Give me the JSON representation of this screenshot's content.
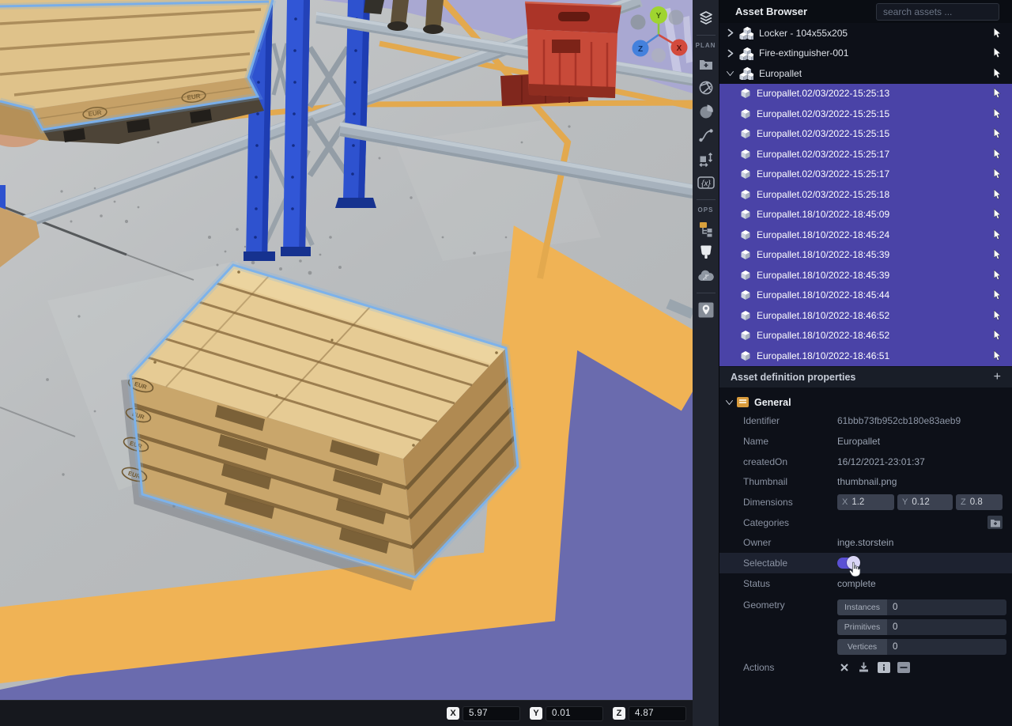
{
  "viewport": {
    "gizmo_axes": {
      "x": "X",
      "y": "Y",
      "z": "Z"
    },
    "status_bar": {
      "x_label": "X",
      "x_value": "5.97",
      "y_label": "Y",
      "y_value": "0.01",
      "z_label": "Z",
      "z_value": "4.87"
    },
    "pallet_brand": "EUR"
  },
  "toolbar": {
    "plan_label": "PLAN",
    "ops_label": "OPS",
    "icons": [
      "assets-stack",
      "add-folder",
      "shutter",
      "pie-chart",
      "spline",
      "measure",
      "variables",
      "structure",
      "paddle",
      "cloud-network",
      "map-location"
    ]
  },
  "asset_browser": {
    "title": "Asset Browser",
    "search_placeholder": "search assets ...",
    "tree": [
      {
        "label": "Locker - 104x55x205",
        "type": "definition",
        "expanded": false,
        "selected": false
      },
      {
        "label": "Fire-extinguisher-001",
        "type": "definition",
        "expanded": false,
        "selected": false
      },
      {
        "label": "Europallet",
        "type": "definition",
        "expanded": true,
        "selected": false
      },
      {
        "label": "Europallet.02/03/2022-15:25:13",
        "type": "instance",
        "selected": true
      },
      {
        "label": "Europallet.02/03/2022-15:25:15",
        "type": "instance",
        "selected": true
      },
      {
        "label": "Europallet.02/03/2022-15:25:15",
        "type": "instance",
        "selected": true
      },
      {
        "label": "Europallet.02/03/2022-15:25:17",
        "type": "instance",
        "selected": true
      },
      {
        "label": "Europallet.02/03/2022-15:25:17",
        "type": "instance",
        "selected": true
      },
      {
        "label": "Europallet.02/03/2022-15:25:18",
        "type": "instance",
        "selected": true
      },
      {
        "label": "Europallet.18/10/2022-18:45:09",
        "type": "instance",
        "selected": true
      },
      {
        "label": "Europallet.18/10/2022-18:45:24",
        "type": "instance",
        "selected": true
      },
      {
        "label": "Europallet.18/10/2022-18:45:39",
        "type": "instance",
        "selected": true
      },
      {
        "label": "Europallet.18/10/2022-18:45:39",
        "type": "instance",
        "selected": true
      },
      {
        "label": "Europallet.18/10/2022-18:45:44",
        "type": "instance",
        "selected": true
      },
      {
        "label": "Europallet.18/10/2022-18:46:52",
        "type": "instance",
        "selected": true
      },
      {
        "label": "Europallet.18/10/2022-18:46:52",
        "type": "instance",
        "selected": true
      },
      {
        "label": "Europallet.18/10/2022-18:46:51",
        "type": "instance",
        "selected": true
      }
    ]
  },
  "properties": {
    "header": "Asset definition properties",
    "add_button": "+",
    "section": "General",
    "rows": {
      "identifier": {
        "label": "Identifier",
        "value": "61bbb73fb952cb180e83aeb9"
      },
      "name": {
        "label": "Name",
        "value": "Europallet"
      },
      "created_on": {
        "label": "createdOn",
        "value": "16/12/2021-23:01:37"
      },
      "thumbnail": {
        "label": "Thumbnail",
        "value": "thumbnail.png"
      },
      "dimensions": {
        "label": "Dimensions",
        "x_label": "X",
        "x": "1.2",
        "y_label": "Y",
        "y": "0.12",
        "z_label": "Z",
        "z": "0.8"
      },
      "categories": {
        "label": "Categories"
      },
      "owner": {
        "label": "Owner",
        "value": "inge.storstein"
      },
      "selectable": {
        "label": "Selectable",
        "on": true
      },
      "status": {
        "label": "Status",
        "value": "complete"
      },
      "geometry": {
        "label": "Geometry",
        "fields": [
          {
            "label": "Instances",
            "value": "0"
          },
          {
            "label": "Primitives",
            "value": "0"
          },
          {
            "label": "Vertices",
            "value": "0"
          }
        ]
      },
      "actions": {
        "label": "Actions"
      }
    }
  },
  "colors": {
    "selection_row": "#4a43a7",
    "toggle_on": "#5a50d4",
    "general_icon": "#d99b3c",
    "floor_purple": "#6a6bae",
    "floor_yellow": "#f0b355",
    "rack_blue": "#2e52cf",
    "selection_outline": "#7db2ea",
    "crate_red": "#c84a39"
  }
}
